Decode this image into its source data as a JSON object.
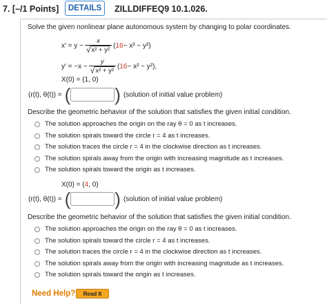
{
  "header": {
    "question_number": "7.",
    "points": "[–/1 Points]",
    "details_button": "DETAILS",
    "question_id": "ZILLDIFFEQ9 10.1.026."
  },
  "instruction": "Solve the given nonlinear plane autonomous system by changing to polar coordinates.",
  "system": {
    "xprime_lhs": "x′ = y −",
    "xprime_num": "x",
    "yprime_lhs": "y′ = −x −",
    "yprime_num": "y",
    "sqrt_arg": "x² + y²",
    "paren_open": "(",
    "constant": "16",
    "paren_rest": " − x² − y²)",
    "yprime_end": ","
  },
  "part1": {
    "ic_label": "X(0) = (1, 0)",
    "solution_lhs": "(r(t), θ(t)) =",
    "solution_note": "(solution of initial value problem)",
    "solution_value": "",
    "describe": "Describe the geometric behavior of the solution that satisfies the given initial condition.",
    "options": [
      "The solution approaches the origin on the ray θ = 0 as t increases.",
      "The solution spirals toward the circle r = 4 as t increases.",
      "The solution traces the circle r = 4 in the clockwise direction as t increases.",
      "The solution spirals away from the origin with increasing magnitude as t increases.",
      "The solution spirals toward the origin as t increases."
    ]
  },
  "part2": {
    "ic_prefix": "X(0) = (",
    "ic_value": "4",
    "ic_suffix": ", 0)",
    "solution_lhs": "(r(t), θ(t)) =",
    "solution_note": "(solution of initial value problem)",
    "solution_value": "",
    "describe": "Describe the geometric behavior of the solution that satisfies the given initial condition.",
    "options": [
      "The solution approaches the origin on the ray θ = 0 as t increases.",
      "The solution spirals toward the circle r = 4 as t increases.",
      "The solution traces the circle r = 4 in the clockwise direction as t increases.",
      "The solution spirals away from the origin with increasing magnitude as t increases.",
      "The solution spirals toward the origin as t increases."
    ]
  },
  "help": {
    "label": "Need Help?",
    "read_it": "Read It"
  },
  "colors": {
    "highlight_red": "#c0392b",
    "details_border": "#3a87d4",
    "help_orange": "#e07b00",
    "read_it_bg": "#f5a623"
  }
}
